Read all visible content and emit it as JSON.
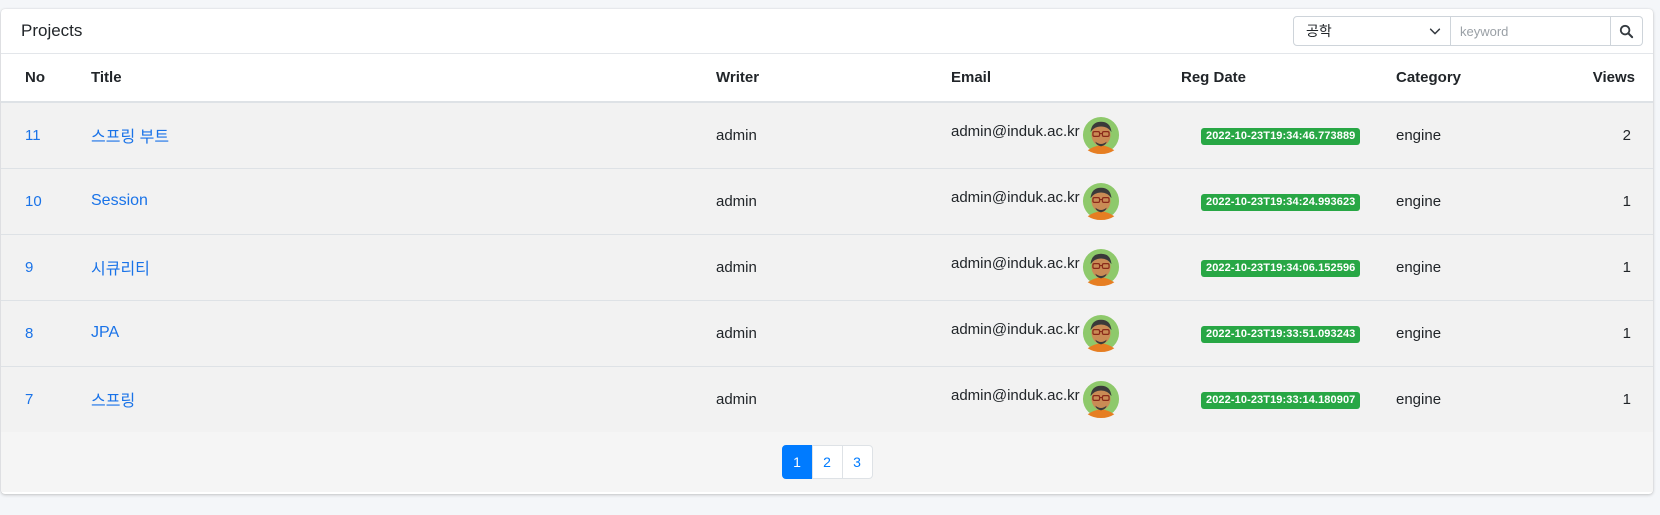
{
  "card": {
    "title": "Projects",
    "search": {
      "category_selected": "공학",
      "keyword_placeholder": "keyword",
      "button_icon": "search-icon"
    }
  },
  "table": {
    "headers": [
      "No",
      "Title",
      "Writer",
      "Email",
      "Reg Date",
      "Category",
      "Views"
    ],
    "rows": [
      {
        "no": "11",
        "title": "스프링 부트",
        "writer": "admin",
        "email": "admin@induk.ac.kr",
        "reg_date": "2022-10-23T19:34:46.773889",
        "category": "engine",
        "views": "2"
      },
      {
        "no": "10",
        "title": "Session",
        "writer": "admin",
        "email": "admin@induk.ac.kr",
        "reg_date": "2022-10-23T19:34:24.993623",
        "category": "engine",
        "views": "1"
      },
      {
        "no": "9",
        "title": "시큐리티",
        "writer": "admin",
        "email": "admin@induk.ac.kr",
        "reg_date": "2022-10-23T19:34:06.152596",
        "category": "engine",
        "views": "1"
      },
      {
        "no": "8",
        "title": "JPA",
        "writer": "admin",
        "email": "admin@induk.ac.kr",
        "reg_date": "2022-10-23T19:33:51.093243",
        "category": "engine",
        "views": "1"
      },
      {
        "no": "7",
        "title": "스프링",
        "writer": "admin",
        "email": "admin@induk.ac.kr",
        "reg_date": "2022-10-23T19:33:14.180907",
        "category": "engine",
        "views": "1"
      }
    ]
  },
  "pagination": {
    "pages": [
      "1",
      "2",
      "3"
    ],
    "active": "1"
  },
  "colors": {
    "link": "#1a73e8",
    "badge": "#28a745",
    "active_page": "#007bff"
  }
}
